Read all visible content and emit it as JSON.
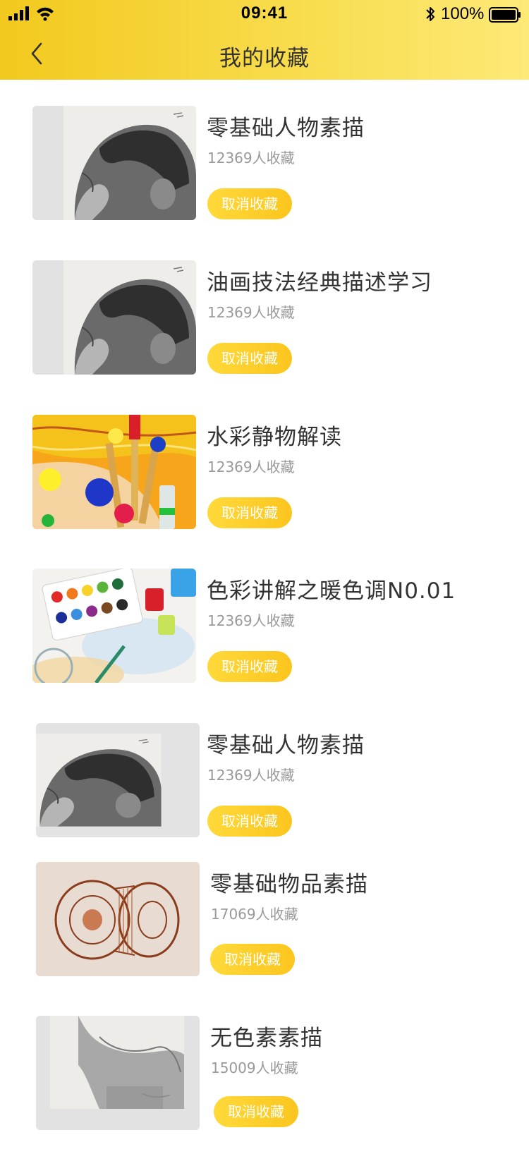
{
  "status_bar": {
    "time": "09:41",
    "battery_percent": "100%",
    "signal_icon": "cellular-signal-icon",
    "wifi_icon": "wifi-icon",
    "bluetooth_icon": "bluetooth-icon",
    "battery_icon": "battery-icon"
  },
  "header": {
    "title": "我的收藏",
    "back_icon": "chevron-left-icon"
  },
  "colors": {
    "header_gradient_start": "#f2c91d",
    "header_gradient_end": "#fde977",
    "button_gradient_start": "#ffd93a",
    "button_gradient_end": "#fbc51e",
    "title_text": "#333333",
    "count_text": "#999999"
  },
  "favorites": [
    {
      "title": "零基础人物素描",
      "count": "12369人收藏",
      "button": "取消收藏",
      "thumbnail": "sketch-portrait"
    },
    {
      "title": "油画技法经典描述学习",
      "count": "12369人收藏",
      "button": "取消收藏",
      "thumbnail": "sketch-portrait"
    },
    {
      "title": "水彩静物解读",
      "count": "12369人收藏",
      "button": "取消收藏",
      "thumbnail": "paintbrushes"
    },
    {
      "title": "色彩讲解之暖色调N0.01",
      "count": "12369人收藏",
      "button": "取消收藏",
      "thumbnail": "watercolor-palette"
    },
    {
      "title": "零基础人物素描",
      "count": "12369人收藏",
      "button": "取消收藏",
      "thumbnail": "sketch-portrait"
    },
    {
      "title": "零基础物品素描",
      "count": "17069人收藏",
      "button": "取消收藏",
      "thumbnail": "sketch-object"
    },
    {
      "title": "无色素素描",
      "count": "15009人收藏",
      "button": "取消收藏",
      "thumbnail": "sketch-statue"
    }
  ]
}
